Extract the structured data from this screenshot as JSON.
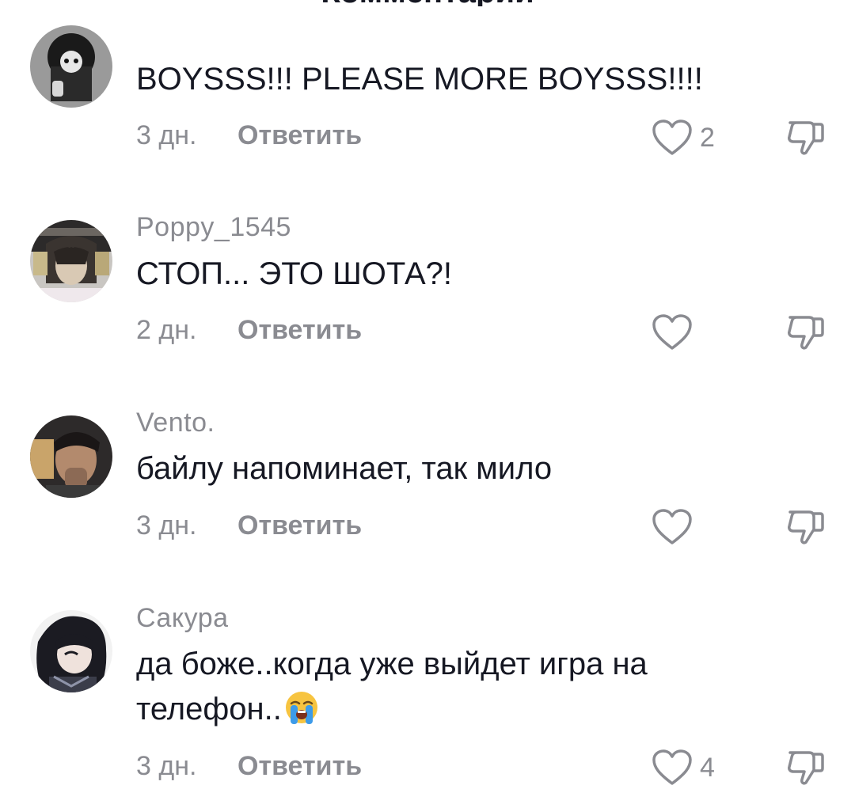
{
  "header": {
    "title": "Комментарии"
  },
  "comments": [
    {
      "username": "",
      "text": "BOYSSS!!! PLEASE MORE BOYSSS!!!!",
      "time": "3 дн.",
      "reply_label": "Ответить",
      "likes": "2"
    },
    {
      "username": "Poppy_1545",
      "text": "СТОП... ЭТО ШОТА?!",
      "time": "2 дн.",
      "reply_label": "Ответить",
      "likes": ""
    },
    {
      "username": "Vento.",
      "text": "байлу напоминает, так мило",
      "time": "3 дн.",
      "reply_label": "Ответить",
      "likes": ""
    },
    {
      "username": "Сакура",
      "text": "да боже..когда уже выйдет игра на телефон..",
      "emoji": "loudly-crying-face-emoji",
      "time": "3 дн.",
      "reply_label": "Ответить",
      "likes": "4"
    }
  ],
  "icons": {
    "like": "heart-outline-icon",
    "dislike": "thumbs-down-outline-icon"
  },
  "colors": {
    "primary_text": "#161823",
    "secondary_text": "#8a8b91"
  }
}
